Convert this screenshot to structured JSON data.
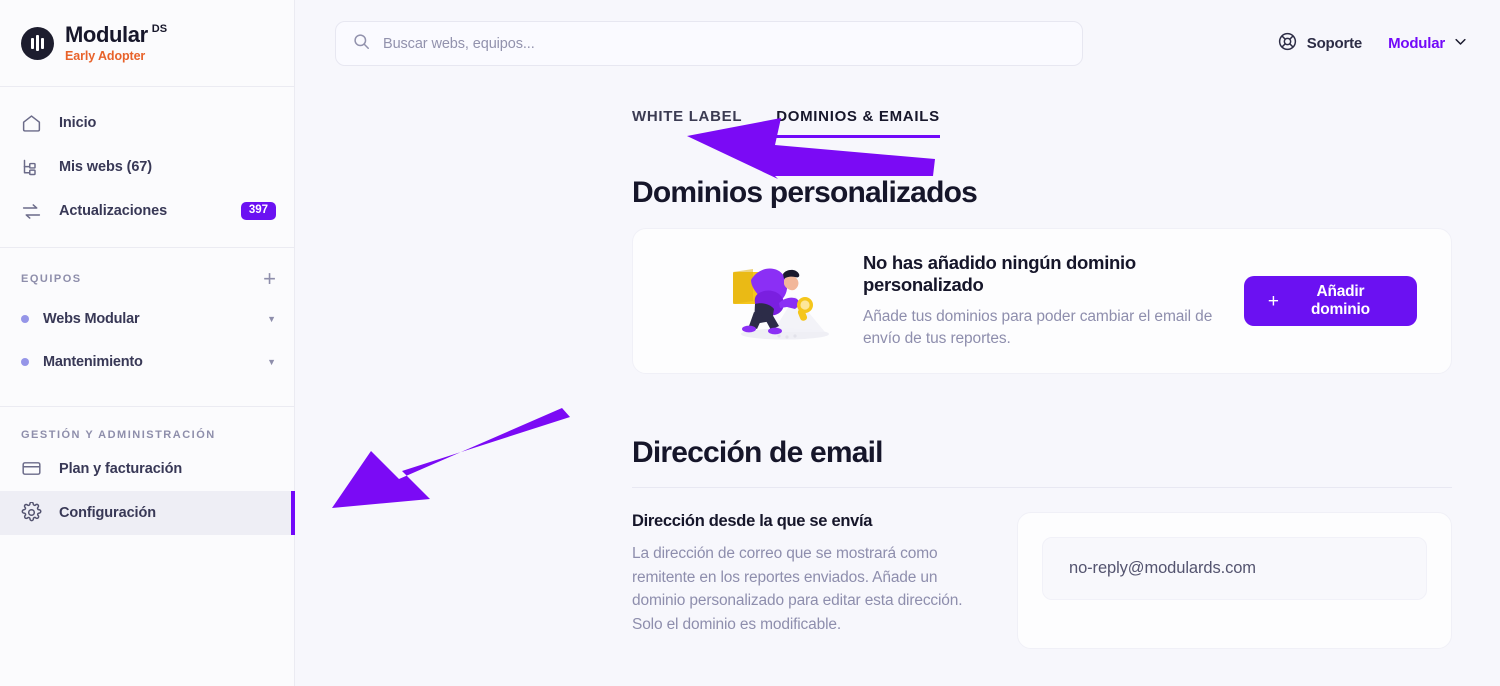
{
  "brand": {
    "name": "Modular",
    "superscript": "DS",
    "tagline": "Early Adopter",
    "logo_icon": "modular-bars-logo"
  },
  "sidebar": {
    "nav": [
      {
        "label": "Inicio",
        "icon": "home-icon",
        "badge": null,
        "active": false
      },
      {
        "label": "Mis webs (67)",
        "icon": "sitemap-icon",
        "badge": null,
        "active": false
      },
      {
        "label": "Actualizaciones",
        "icon": "updates-icon",
        "badge": "397",
        "active": false
      }
    ],
    "teams_group": {
      "title": "EQUIPOS",
      "add_icon": "plus-icon",
      "items": [
        {
          "label": "Webs Modular",
          "dot_color": "#9595e8",
          "caret": "chevron-down-icon"
        },
        {
          "label": "Mantenimiento",
          "dot_color": "#9595e8",
          "caret": "chevron-down-icon"
        }
      ]
    },
    "admin_group": {
      "title": "GESTIÓN Y ADMINISTRACIÓN",
      "items": [
        {
          "label": "Plan y facturación",
          "icon": "credit-card-icon",
          "active": false
        },
        {
          "label": "Configuración",
          "icon": "gear-icon",
          "active": true
        }
      ]
    }
  },
  "topbar": {
    "search": {
      "placeholder": "Buscar webs, equipos...",
      "value": "",
      "icon": "search-icon"
    },
    "support": {
      "label": "Soporte",
      "icon": "lifebuoy-icon"
    },
    "account": {
      "label": "Modular",
      "caret": "chevron-down-icon"
    }
  },
  "tabs": [
    {
      "label": "WHITE LABEL",
      "active": false
    },
    {
      "label": "DOMINIOS & EMAILS",
      "active": true
    }
  ],
  "domains_section": {
    "heading": "Dominios personalizados",
    "empty_state": {
      "illustration": "person-with-box-and-flashlight-illustration",
      "title": "No has añadido ningún dominio personalizado",
      "description": "Añade tus dominios para poder cambiar el email de envío de tus reportes.",
      "button": {
        "label": "Añadir dominio",
        "plus": "+",
        "color": "#6b11f2"
      }
    }
  },
  "email_section": {
    "heading": "Dirección de email",
    "subtitle": "Dirección desde la que se envía",
    "description": "La dirección de correo que se mostrará como remitente en los reportes enviados. Añade un dominio personalizado para editar esta dirección. Solo el dominio es modificable.",
    "email_field": {
      "value": "no-reply@modulards.com",
      "readonly": true
    }
  },
  "annotations": {
    "arrow_color": "#7b0af5",
    "arrows": [
      {
        "name": "arrow-pointing-to-dominios-emails-tab"
      },
      {
        "name": "arrow-pointing-to-direccion-de-email"
      }
    ]
  }
}
